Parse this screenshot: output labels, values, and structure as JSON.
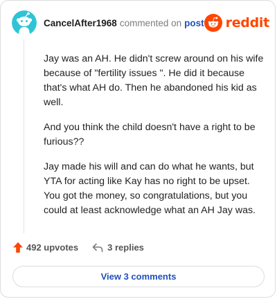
{
  "comment": {
    "username": "CancelAfter1968",
    "action_text": "commented on",
    "post_link": "post",
    "avatar_icon": "reddit-snoo-avatar-icon",
    "paragraphs": [
      "Jay was an AH. He didn't screw around on his wife because of \"fertility issues \". He did it because that's what AH do. Then he abandoned his kid as well.",
      "And you think the child doesn't have a right to be furious??",
      "Jay made his will and can do what he wants, but YTA for acting like Kay has no right to be upset. You got the money, so congratulations, but you could at least acknowledge what an AH Jay was."
    ]
  },
  "brand": {
    "wordmark": "reddit",
    "icon": "reddit-logo-icon",
    "color": "#ff4500"
  },
  "footer": {
    "upvotes_label": "492 upvotes",
    "upvote_icon": "upvote-arrow-icon",
    "upvote_color": "#ff4500",
    "replies_label": "3 replies",
    "reply_icon": "reply-arrow-icon"
  },
  "view_comments_label": "View 3 comments",
  "colors": {
    "link": "#1f4fbf",
    "avatar_bg": "#2ec4d6"
  }
}
